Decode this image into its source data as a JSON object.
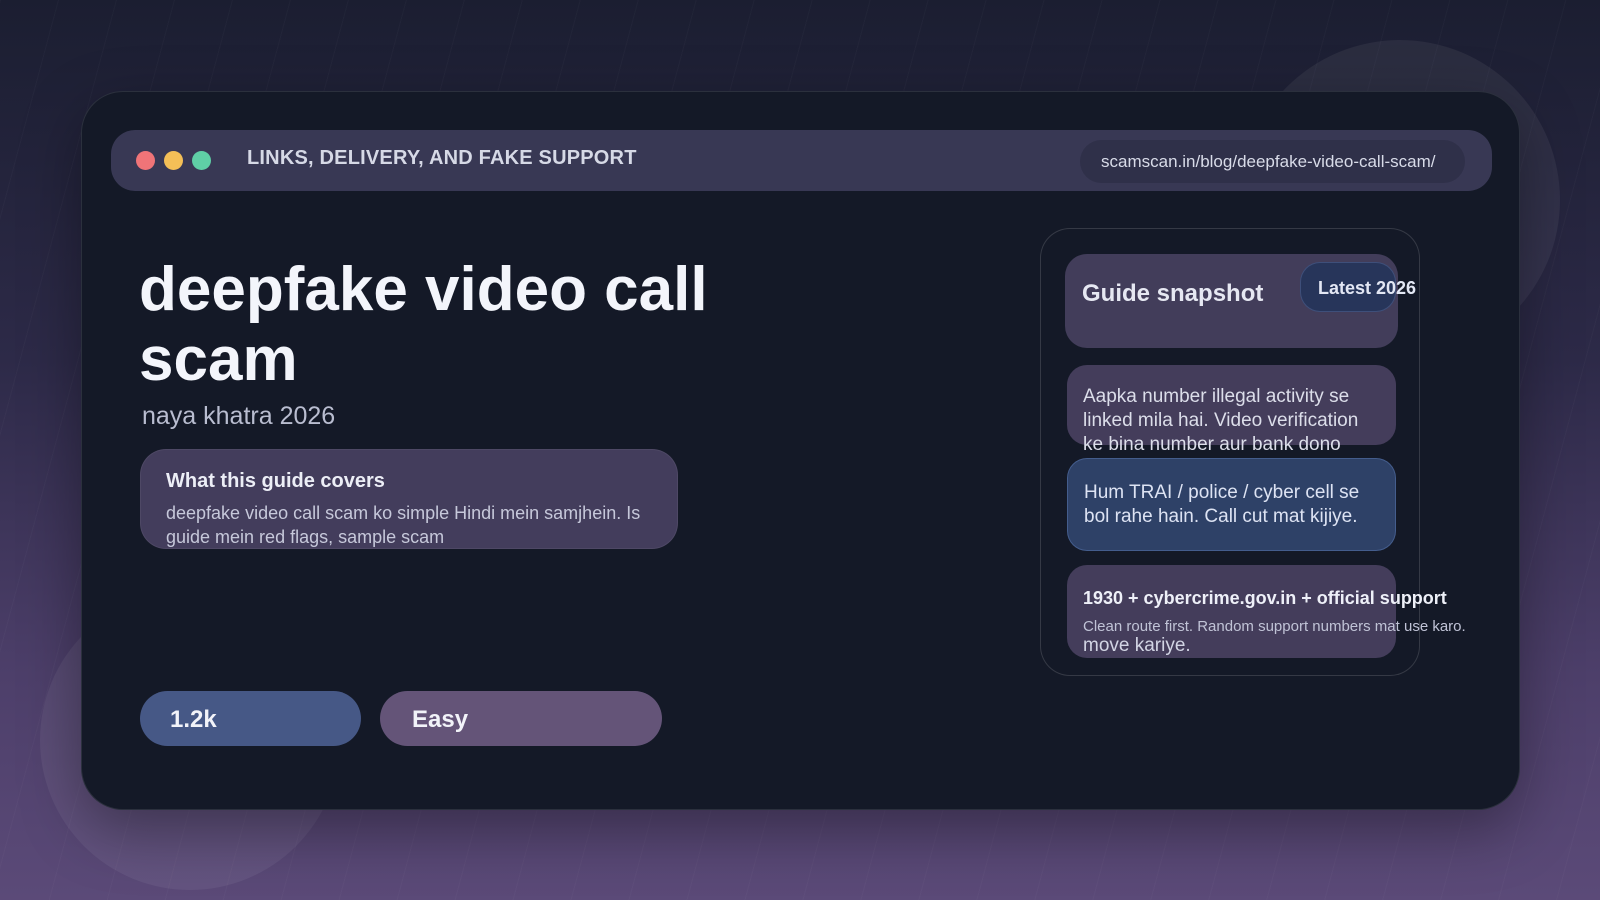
{
  "window": {
    "title": "LINKS, DELIVERY, AND FAKE SUPPORT",
    "url": "scamscan.in/blog/deepfake-video-call-scam/"
  },
  "hero": {
    "title": "deepfake video call scam",
    "subtitle": "naya khatra 2026"
  },
  "guide_card": {
    "title": "What this guide covers",
    "body": "deepfake video call scam ko simple Hindi mein samjhein. Is guide mein red flags, sample scam"
  },
  "stats": {
    "views": "1.2k",
    "difficulty": "Easy"
  },
  "snapshot": {
    "title": "Guide snapshot",
    "badge": "Latest 2026",
    "message_scammer": "Aapka number illegal activity se linked mila hai. Video verification ke bina number aur bank dono",
    "message_scammer_tail": "move kariye.",
    "message_authority": "Hum TRAI / police / cyber cell se bol rahe hain. Call cut mat kijiye.",
    "route_title": "1930 + cybercrime.gov.in + official support",
    "route_note": "Clean route first. Random support numbers mat use karo."
  },
  "colors": {
    "dot_red": "#f07478",
    "dot_yellow": "#f4bf57",
    "dot_green": "#5fcfa6",
    "accent_blue": "#465886",
    "accent_purple": "#645478"
  }
}
